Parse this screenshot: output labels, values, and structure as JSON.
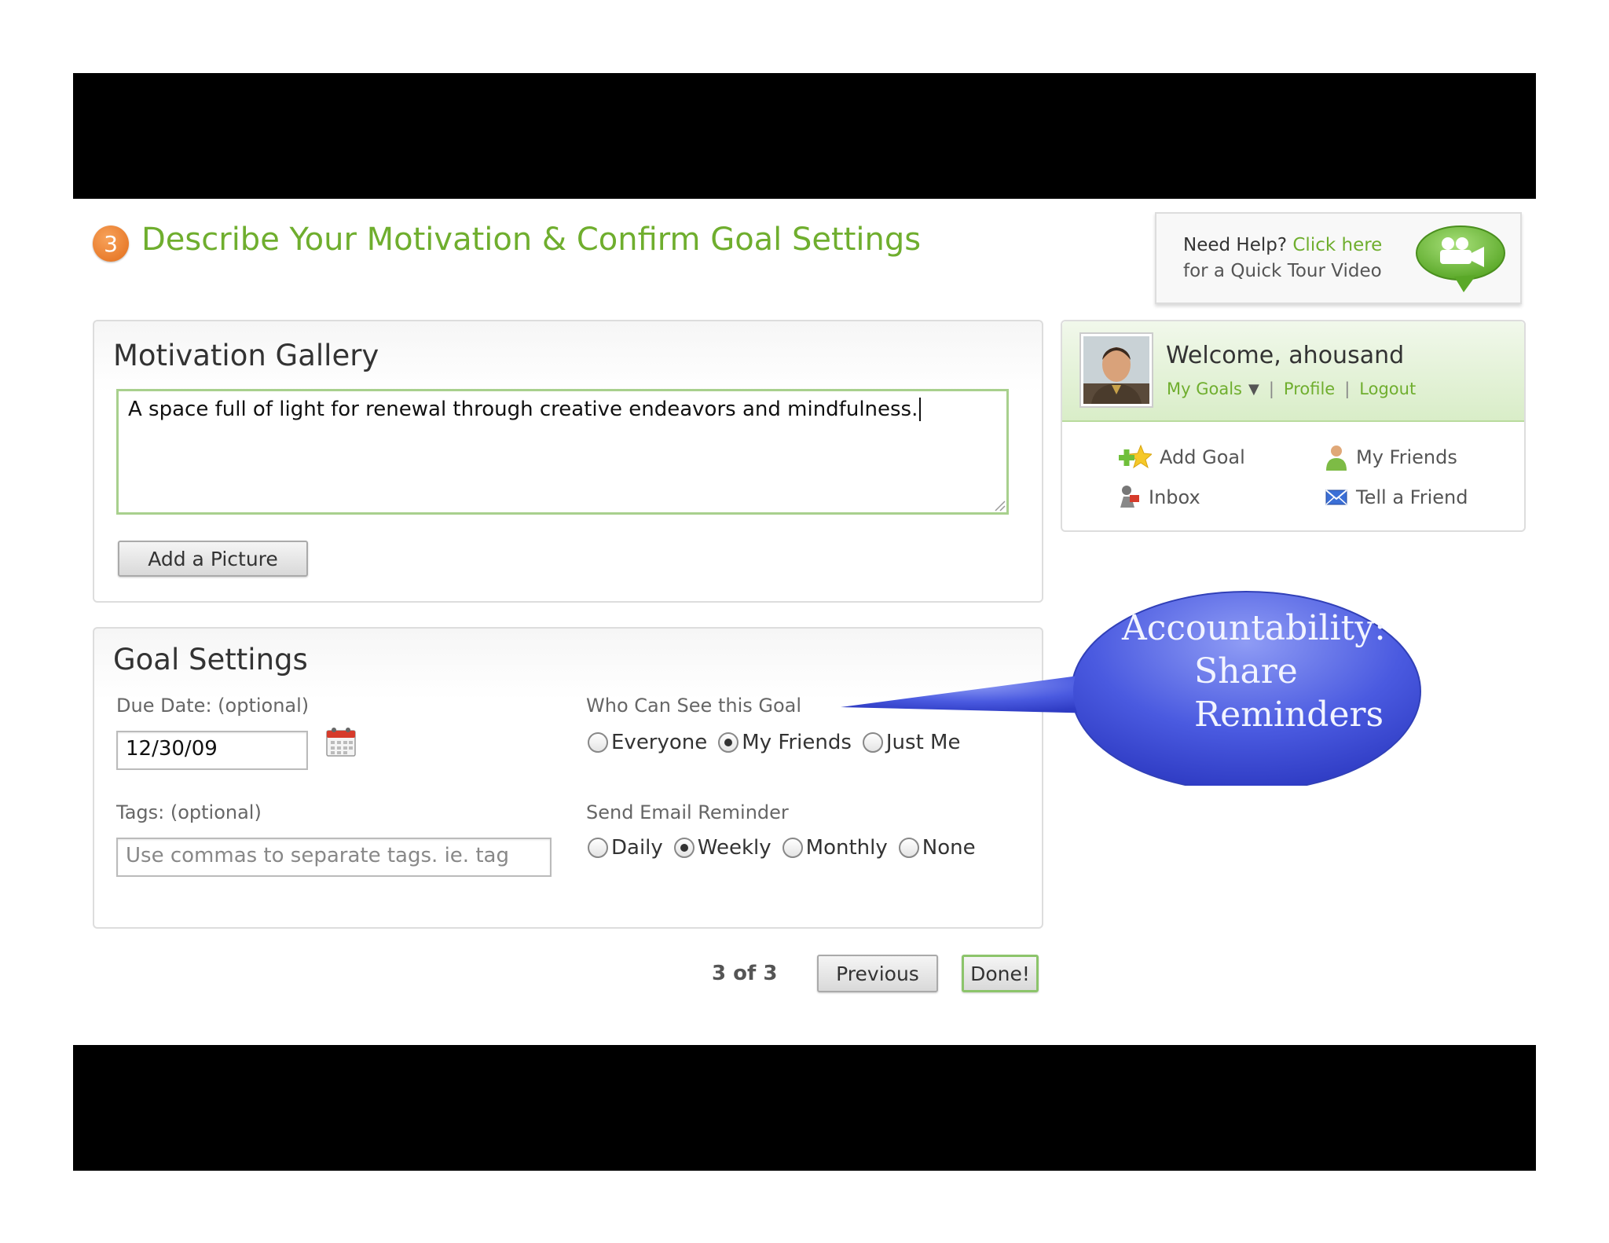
{
  "header": {
    "step_number": "3",
    "title": "Describe Your Motivation & Confirm Goal Settings"
  },
  "help": {
    "prefix": "Need Help? ",
    "link": "Click here",
    "line2": "for a Quick Tour Video",
    "icon": "video-chat-bubble-icon"
  },
  "gallery": {
    "title": "Motivation Gallery",
    "motivation_text": "A space full of light for renewal through creative endeavors and mindfulness.",
    "add_picture_label": "Add a Picture"
  },
  "settings": {
    "title": "Goal Settings",
    "due_label": "Due Date: (optional)",
    "due_value": "12/30/09",
    "tags_label": "Tags: (optional)",
    "tags_placeholder": "Use commas to separate tags.  ie. tag",
    "who_label": "Who Can See this Goal",
    "who_options": [
      {
        "label": "Everyone",
        "checked": false
      },
      {
        "label": "My Friends",
        "checked": true
      },
      {
        "label": "Just Me",
        "checked": false
      }
    ],
    "email_label": "Send Email Reminder",
    "email_options": [
      {
        "label": "Daily",
        "checked": false
      },
      {
        "label": "Weekly",
        "checked": true
      },
      {
        "label": "Monthly",
        "checked": false
      },
      {
        "label": "None",
        "checked": false
      }
    ]
  },
  "nav": {
    "page_count": "3 of 3",
    "previous_label": "Previous",
    "done_label": "Done!"
  },
  "user": {
    "welcome": "Welcome, ahousand",
    "links": {
      "my_goals": "My Goals",
      "profile": "Profile",
      "logout": "Logout"
    },
    "actions": {
      "add_goal": "Add Goal",
      "my_friends": "My Friends",
      "inbox": "Inbox",
      "tell_friend": "Tell a Friend"
    }
  },
  "callout": {
    "line1": "Accountability:",
    "line2": "Share",
    "line3": "Reminders"
  },
  "colors": {
    "brand_green": "#6fae2e",
    "step_orange": "#e36d1a",
    "callout_blue": "#4a5ae0"
  }
}
